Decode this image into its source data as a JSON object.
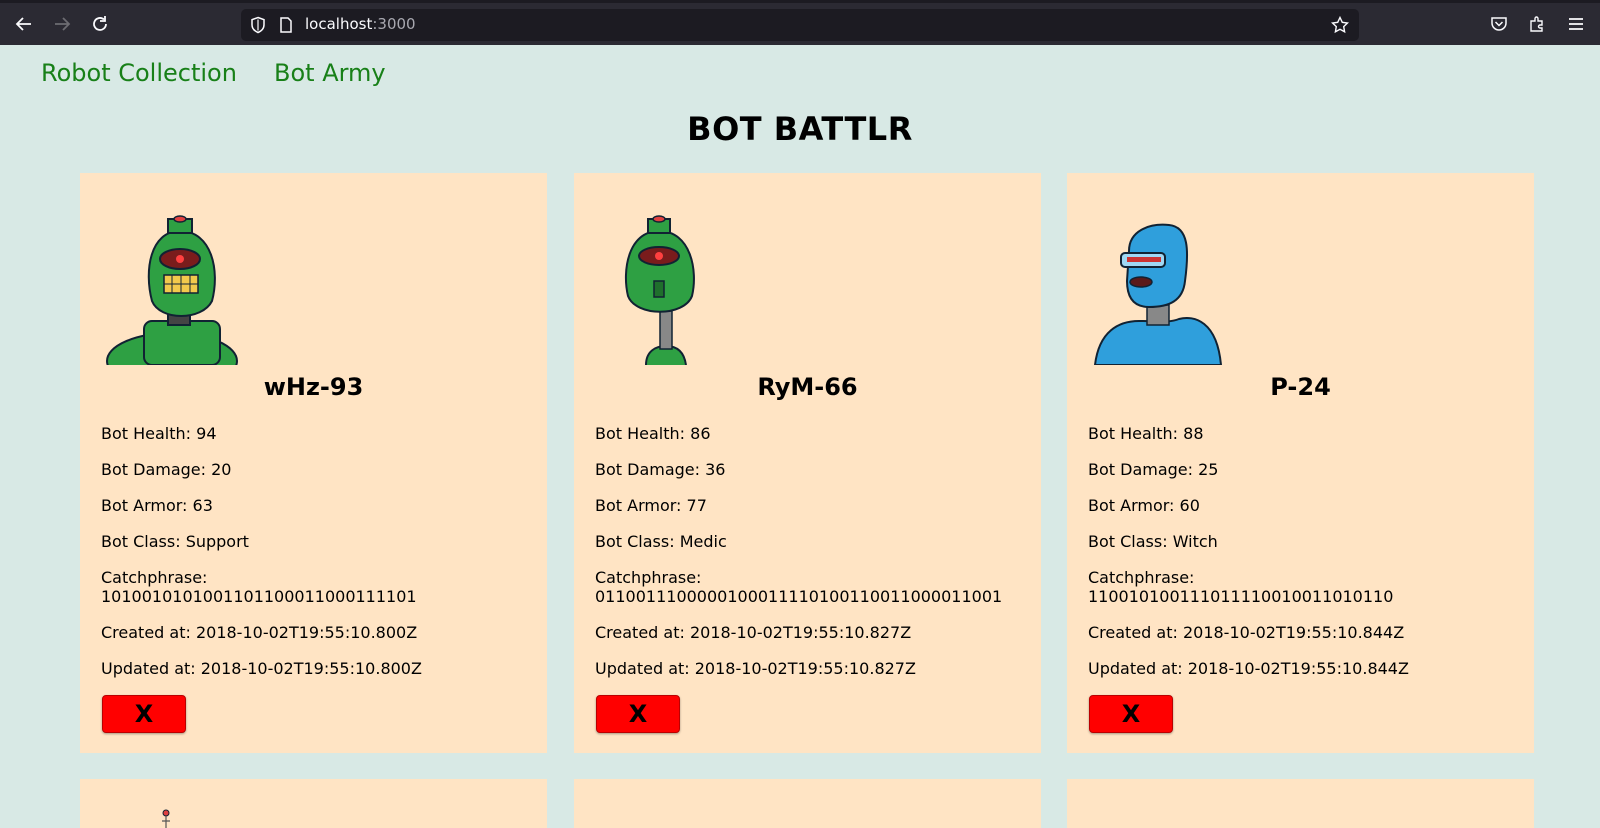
{
  "browser": {
    "url_host": "localhost",
    "url_port": ":3000"
  },
  "nav": {
    "collection_label": "Robot Collection",
    "army_label": "Bot Army"
  },
  "page_title": "BOT BATTLR",
  "delete_label": "X",
  "bots": [
    {
      "name": "wHz-93",
      "health": "Bot Health: 94",
      "damage": "Bot Damage: 20",
      "armor": "Bot Armor: 63",
      "bot_class": "Bot Class: Support",
      "catchphrase_label": "Catchphrase:",
      "catchphrase": "1010010101001101100011000111101",
      "created": "Created at: 2018-10-02T19:55:10.800Z",
      "updated": "Updated at: 2018-10-02T19:55:10.800Z",
      "color": "#2ea043"
    },
    {
      "name": "RyM-66",
      "health": "Bot Health: 86",
      "damage": "Bot Damage: 36",
      "armor": "Bot Armor: 77",
      "bot_class": "Bot Class: Medic",
      "catchphrase_label": "Catchphrase:",
      "catchphrase": "0110011100000100011110100110011000011001",
      "created": "Created at: 2018-10-02T19:55:10.827Z",
      "updated": "Updated at: 2018-10-02T19:55:10.827Z",
      "color": "#2ea043"
    },
    {
      "name": "P-24",
      "health": "Bot Health: 88",
      "damage": "Bot Damage: 25",
      "armor": "Bot Armor: 60",
      "bot_class": "Bot Class: Witch",
      "catchphrase_label": "Catchphrase:",
      "catchphrase": "110010100111011110010011010110",
      "created": "Created at: 2018-10-02T19:55:10.844Z",
      "updated": "Updated at: 2018-10-02T19:55:10.844Z",
      "color": "#2f9fdc"
    }
  ],
  "colors": {
    "page_bg": "#d8e9e5",
    "card_bg": "#ffe4c4",
    "link": "#188018",
    "delete_button": "#ff0000"
  }
}
